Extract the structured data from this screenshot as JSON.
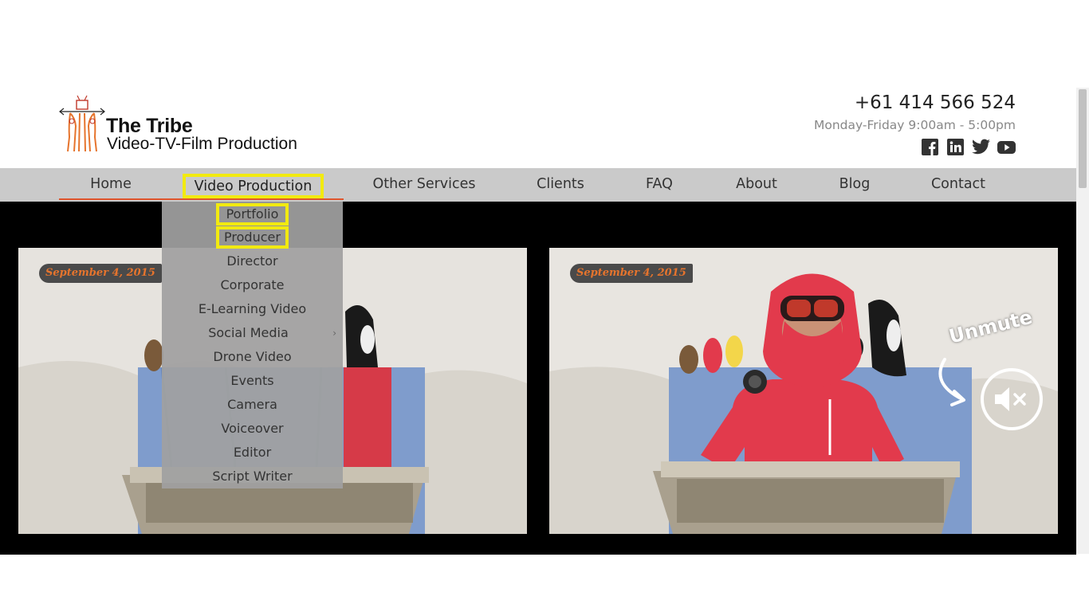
{
  "brand": {
    "title": "The Tribe",
    "subtitle": "Video-TV-Film Production"
  },
  "contact": {
    "phone": "+61 414 566 524",
    "hours": "Monday-Friday  9:00am - 5:00pm"
  },
  "social": [
    {
      "icon": "facebook-icon"
    },
    {
      "icon": "linkedin-icon"
    },
    {
      "icon": "twitter-icon"
    },
    {
      "icon": "youtube-icon"
    }
  ],
  "nav": {
    "home": "Home",
    "video_production": "Video Production",
    "other_services": "Other Services",
    "clients": "Clients",
    "faq": "FAQ",
    "about": "About",
    "blog": "Blog",
    "contact": "Contact"
  },
  "dropdown": {
    "items": [
      "Portfolio",
      "Producer",
      "Director",
      "Corporate",
      "E-Learning Video",
      "Social Media",
      "Drone Video",
      "Events",
      "Camera",
      "Voiceover",
      "Editor",
      "Script Writer"
    ],
    "submenu_indicator": "›"
  },
  "videos": {
    "left_date": "September 4, 2015",
    "right_date": "September 4, 2015",
    "unmute_label": "Unmute"
  },
  "colors": {
    "accent": "#e0562e",
    "highlight_box": "#f2ea10",
    "nav_bg": "#cacaca",
    "jacket": "#e23a4c"
  }
}
